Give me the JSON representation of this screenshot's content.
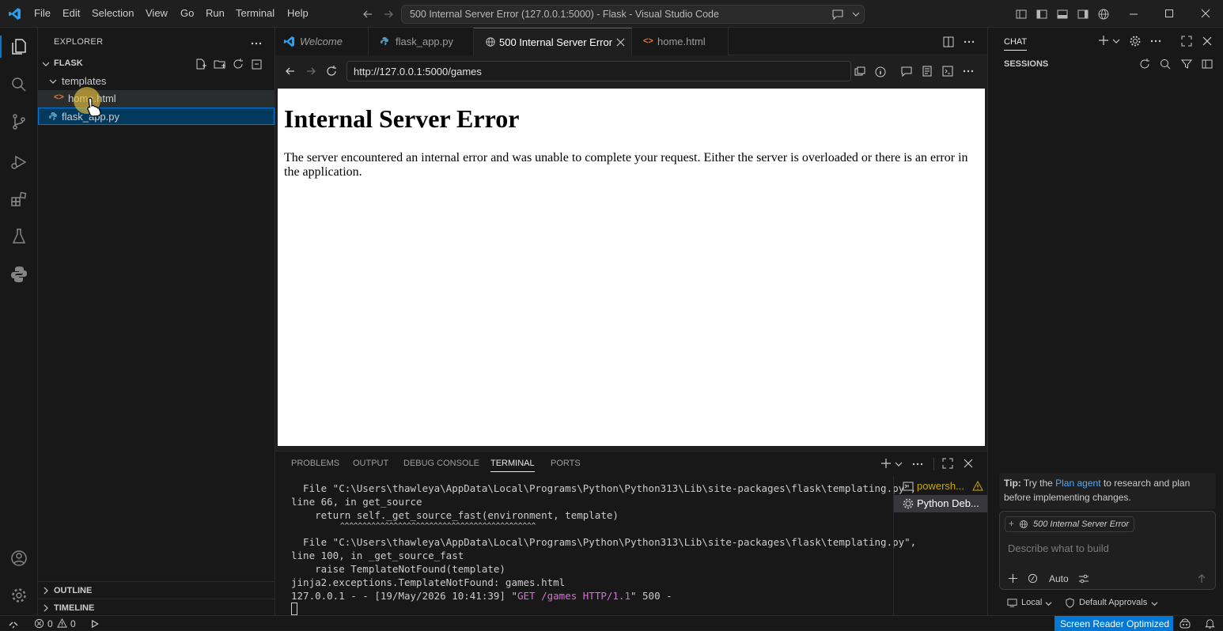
{
  "titlebar": {
    "menu": [
      "File",
      "Edit",
      "Selection",
      "View",
      "Go",
      "Run",
      "Terminal",
      "Help"
    ],
    "title": "500 Internal Server Error (127.0.0.1:5000) - Flask - Visual Studio Code"
  },
  "explorer": {
    "title": "EXPLORER",
    "root": "FLASK",
    "folder": "templates",
    "files": [
      "home.html",
      "flask_app.py"
    ],
    "outline": "OUTLINE",
    "timeline": "TIMELINE"
  },
  "tabs": [
    {
      "label": "Welcome",
      "icon": "vscode-icon"
    },
    {
      "label": "flask_app.py",
      "icon": "python-icon"
    },
    {
      "label": "500 Internal Server Error",
      "icon": "globe-icon",
      "active": true
    },
    {
      "label": "home.html",
      "icon": "html-icon"
    }
  ],
  "browser": {
    "url": "http://127.0.0.1:5000/games"
  },
  "page": {
    "heading": "Internal Server Error",
    "body": "The server encountered an internal error and was unable to complete your request. Either the server is overloaded or there is an error in the application."
  },
  "panel": {
    "tabs": [
      "PROBLEMS",
      "OUTPUT",
      "DEBUG CONSOLE",
      "TERMINAL",
      "PORTS"
    ],
    "active_tab": "TERMINAL",
    "terminal_lines": [
      "  File \"C:\\Users\\thawleya\\AppData\\Local\\Programs\\Python\\Python313\\Lib\\site-packages\\flask\\templating.py\",",
      "line 66, in get_source",
      "    return self._get_source_fast(environment, template)",
      "           ^^^^^^^^^^^^^^^^^^^^^^^^^^^^^^^^^^^^^^^^^^^^",
      "  File \"C:\\Users\\thawleya\\AppData\\Local\\Programs\\Python\\Python313\\Lib\\site-packages\\flask\\templating.py\",",
      "line 100, in _get_source_fast",
      "    raise TemplateNotFound(template)",
      "jinja2.exceptions.TemplateNotFound: games.html"
    ],
    "last_line_prefix": "127.0.0.1 - - [19/May/2026 10:41:39] \"",
    "last_line_request": "GET /games HTTP/1.1",
    "last_line_suffix": "\" 500 -",
    "terminals": [
      "powersh...",
      "Python Deb..."
    ]
  },
  "chat": {
    "title": "CHAT",
    "sessions": "SESSIONS",
    "tip_label": "Tip:",
    "tip_pre": " Try the ",
    "tip_link": "Plan agent",
    "tip_post": " to research and plan before implementing changes.",
    "context_chip": "500 Internal Server Error",
    "input_placeholder": "Describe what to build",
    "mode": "Auto",
    "location": "Local",
    "approvals": "Default Approvals"
  },
  "statusbar": {
    "errors": "0",
    "warnings": "0",
    "screen_reader": "Screen Reader Optimized"
  },
  "colors": {
    "accent": "#0078d4",
    "link": "#4daafc",
    "magenta": "#d670d6",
    "html_icon": "#e37933",
    "python_icon": "#519aba"
  }
}
